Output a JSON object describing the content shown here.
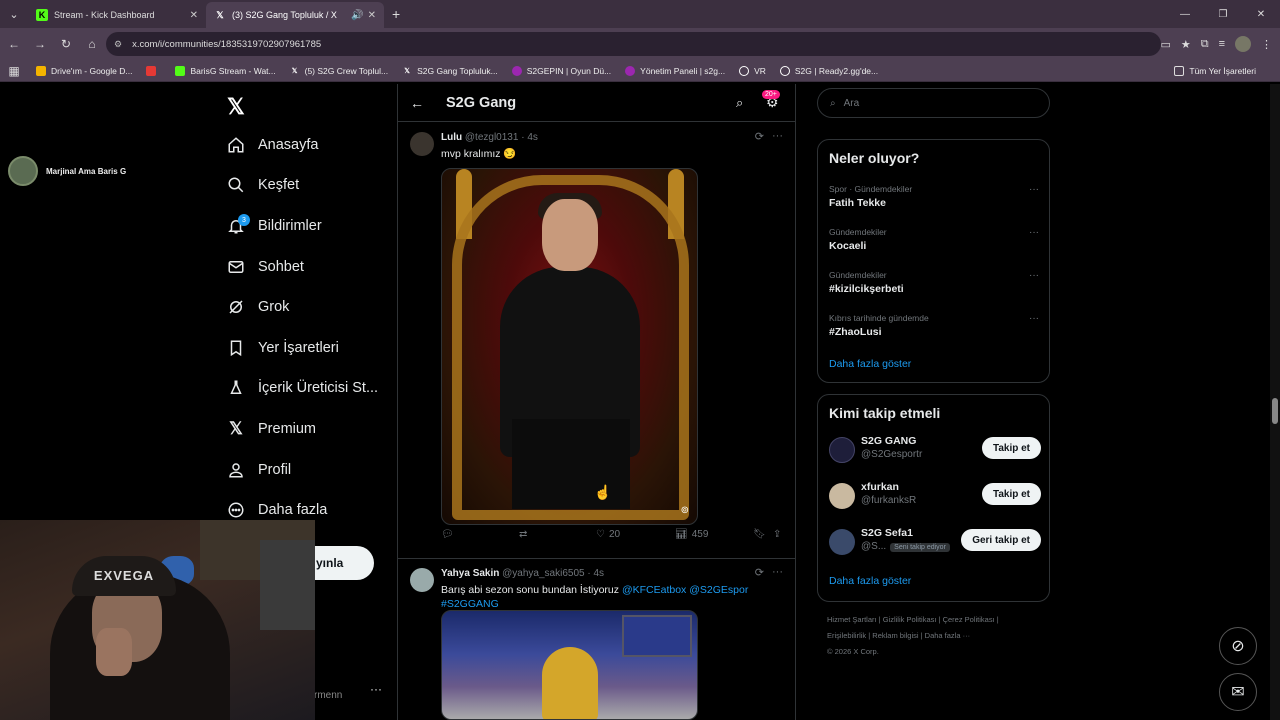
{
  "browser": {
    "tabs": [
      {
        "title": "Stream - Kick Dashboard",
        "favicon": "kick-icon",
        "active": false
      },
      {
        "title": "(3) S2G Gang Topluluk / X",
        "favicon": "x-icon",
        "active": true
      }
    ],
    "url": "x.com/i/communities/1835319702907961785",
    "bookmarks": [
      {
        "label": "Drive'ım - Google D...",
        "color": "#f4b400"
      },
      {
        "label": "",
        "color": "#e53935"
      },
      {
        "label": "BarisG Stream - Wat...",
        "color": "#53fc18"
      },
      {
        "label": "(5) S2G Crew Toplul...",
        "color": "#ffffff"
      },
      {
        "label": "S2G Gang Topluluk...",
        "color": "#ffffff"
      },
      {
        "label": "S2GEPIN | Oyun Dü...",
        "color": "#9c27b0"
      },
      {
        "label": "Yönetim Paneli | s2g...",
        "color": "#9c27b0"
      },
      {
        "label": "VR",
        "color": "#ffffff"
      },
      {
        "label": "S2G | Ready2.gg'de...",
        "color": "#ffffff"
      }
    ],
    "all_bookmarks": "Tüm Yer İşaretleri"
  },
  "streamer": {
    "name": "Marjinal Ama Baris G"
  },
  "webcam": {
    "hat_text": "EXVEGA"
  },
  "nav": {
    "items": [
      {
        "label": "Anasayfa",
        "icon": "home-icon"
      },
      {
        "label": "Keşfet",
        "icon": "search-icon"
      },
      {
        "label": "Bildirimler",
        "icon": "bell-icon",
        "badge": "3"
      },
      {
        "label": "Sohbet",
        "icon": "mail-icon"
      },
      {
        "label": "Grok",
        "icon": "grok-icon"
      },
      {
        "label": "Yer İşaretleri",
        "icon": "bookmark-icon"
      },
      {
        "label": "İçerik Üreticisi St...",
        "icon": "flask-icon"
      },
      {
        "label": "Premium",
        "icon": "x-premium-icon"
      },
      {
        "label": "Profil",
        "icon": "person-icon"
      },
      {
        "label": "Daha fazla",
        "icon": "more-circle-icon"
      }
    ],
    "post_button": "yınla",
    "account_partial": "rmenn",
    "account_more": "···"
  },
  "feed": {
    "title": "S2G Gang",
    "notif_count": "20+",
    "posts": [
      {
        "name": "Lulu",
        "handle": "@tezgl0131",
        "time": "4s",
        "text": "mvp kralımız 😏",
        "likes": "20",
        "views": "459"
      },
      {
        "name": "Yahya Sakin",
        "handle": "@yahya_saki6505",
        "time": "4s",
        "text": "Barış abi sezon sonu bundan İstiyoruz ",
        "mentions": "@KFCEatbox @S2GEspor",
        "hashtag": "#S2GGANG"
      }
    ]
  },
  "search": {
    "placeholder": "Ara"
  },
  "trends": {
    "title": "Neler oluyor?",
    "items": [
      {
        "category": "Spor · Gündemdekiler",
        "name": "Fatih Tekke"
      },
      {
        "category": "Gündemdekiler",
        "name": "Kocaeli"
      },
      {
        "category": "Gündemdekiler",
        "name": "#kizilcikşerbeti"
      },
      {
        "category": "Kıbrıs tarihinde gündemde",
        "name": "#ZhaoLusi"
      }
    ],
    "more": "Daha fazla göster"
  },
  "who_to_follow": {
    "title": "Kimi takip etmeli",
    "items": [
      {
        "name": "S2G GANG",
        "handle": "@S2Gesportr",
        "button": "Takip et",
        "pill": ""
      },
      {
        "name": "xfurkan",
        "handle": "@furkanksR",
        "button": "Takip et",
        "pill": ""
      },
      {
        "name": "S2G Sefa1",
        "handle": "@S...",
        "button": "Geri takip et",
        "pill": "Seni takip ediyor"
      }
    ],
    "more": "Daha fazla göster"
  },
  "footer": {
    "line1": "Hizmet Şartları  |  Gizlilik Politikası  |  Çerez Politikası  |",
    "line2": "Erişilebilirlik  |  Reklam bilgisi  |  Daha fazla ···",
    "line3": "© 2026 X Corp."
  }
}
